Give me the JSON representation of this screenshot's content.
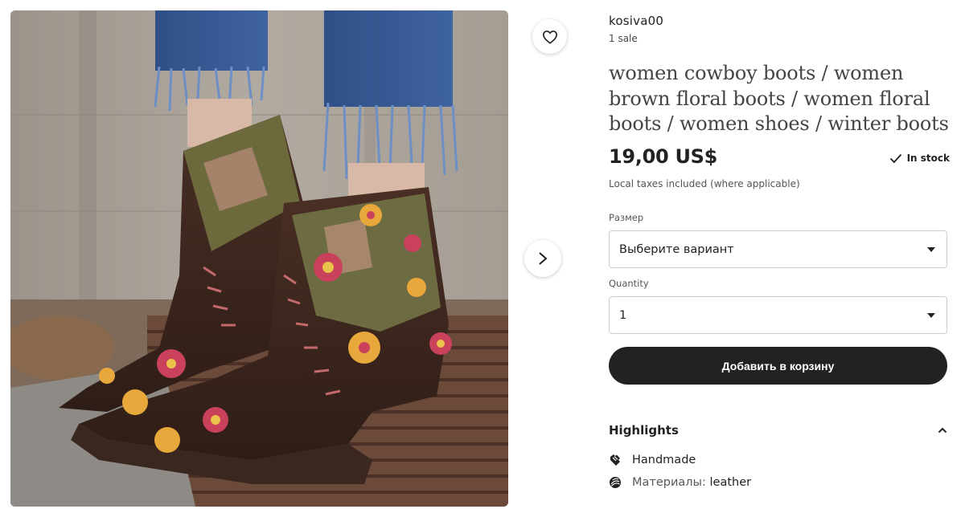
{
  "listing": {
    "shop_name": "kosiva00",
    "sales": "1 sale",
    "title": "women cowboy boots / women brown floral boots / women floral boots / women shoes / winter boots",
    "price": "19,00 US$",
    "stock": "In stock",
    "taxes_note": "Local taxes included (where applicable)"
  },
  "options": {
    "size_label": "Размер",
    "size_value": "Выберите вариант",
    "quantity_label": "Quantity",
    "quantity_value": "1"
  },
  "actions": {
    "add_to_cart": "Добавить в корзину"
  },
  "highlights": {
    "title": "Highlights",
    "items": [
      {
        "icon": "hand-icon",
        "label": "",
        "value": "Handmade"
      },
      {
        "icon": "material-icon",
        "label": "Материалы:",
        "value": "leather"
      }
    ]
  },
  "icons": {
    "favorite": "heart-icon",
    "next": "chevron-right-icon",
    "stock": "check-icon",
    "collapse": "chevron-up-icon"
  },
  "colors": {
    "button_bg": "#222222",
    "text_primary": "#222222",
    "text_muted": "#595959"
  }
}
